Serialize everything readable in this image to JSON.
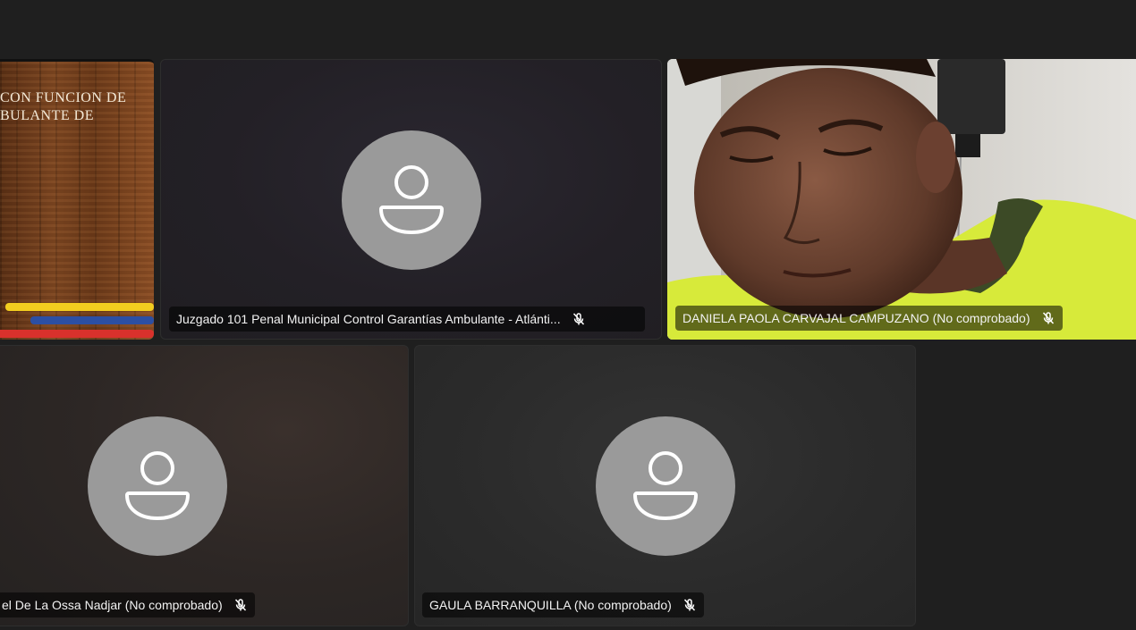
{
  "presentation": {
    "line1": "CON FUNCION DE",
    "line2": "BULANTE DE",
    "flag_colors": [
      "#f2cd1f",
      "#2c4fa3",
      "#d9312c"
    ]
  },
  "participants": [
    {
      "name": "Juzgado 101 Penal Municipal Control Garantías Ambulante - Atlánti...",
      "muted": true,
      "video": false
    },
    {
      "name": "DANIELA PAOLA CARVAJAL CAMPUZANO (No comprobado)",
      "muted": true,
      "video": true
    },
    {
      "name": "el De La Ossa Nadjar (No comprobado)",
      "muted": true,
      "video": false
    },
    {
      "name": "GAULA BARRANQUILLA (No comprobado)",
      "muted": true,
      "video": false
    }
  ],
  "icons": {
    "avatar": "person-icon",
    "mute": "microphone-off-icon"
  },
  "colors": {
    "background": "#1f1f1f",
    "avatar": "#9a9a9a",
    "label_bg": "rgba(0,0,0,0.55)"
  }
}
